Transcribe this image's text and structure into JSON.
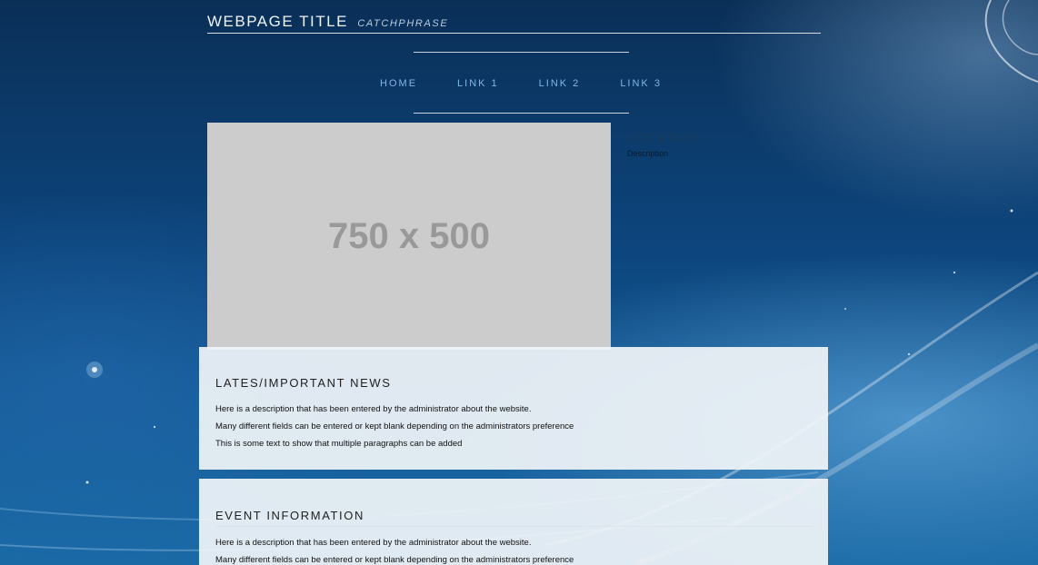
{
  "header": {
    "title": "WEBPAGE TITLE",
    "catchphrase": "CATCHPHRASE"
  },
  "nav": {
    "items": [
      "HOME",
      "LINK 1",
      "LINK 2",
      "LINK 3"
    ]
  },
  "hero": {
    "placeholder_text": "750 x 500"
  },
  "location": {
    "title": "LOCATION",
    "description": "Description"
  },
  "news": {
    "title": "LATES/IMPORTANT NEWS",
    "paragraphs": [
      "Here is a description that has been entered by the administrator about the website.",
      "Many different fields can be entered or kept blank depending on the administrators preference",
      "This is some text to show that multiple paragraphs can be added"
    ]
  },
  "event": {
    "title": "EVENT INFORMATION",
    "paragraphs": [
      "Here is a description that has been entered by the administrator about the website.",
      "Many different fields can be entered or kept blank depending on the administrators preference"
    ]
  },
  "colors": {
    "nav_link": "#7fb6e6",
    "placeholder_bg": "#cccccc",
    "panel_bg": "#f0f4f8"
  }
}
